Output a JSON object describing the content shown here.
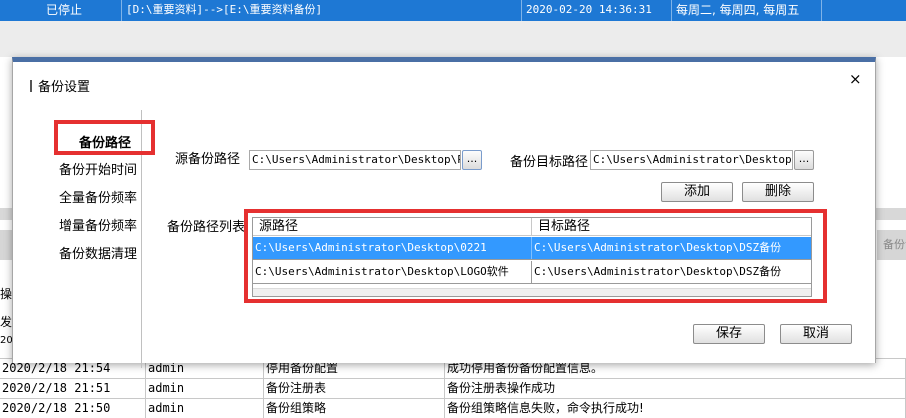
{
  "background": {
    "top_row": {
      "status": "已停止",
      "paths": "[D:\\重要资料]-->[E:\\重要资料备份]",
      "datetime": "2020-02-20 14:36:31",
      "schedule": "每周二, 每周四, 每周五"
    },
    "left_fragments": [
      "操",
      "发",
      "20"
    ],
    "right_fragment": "备份计",
    "log_rows": [
      {
        "time": "2020/2/18 21:54",
        "user": "admin",
        "action": "停用备份配置",
        "message": "成功停用备份备份配置信息。"
      },
      {
        "time": "2020/2/18 21:51",
        "user": "admin",
        "action": "备份注册表",
        "message": "备份注册表操作成功"
      },
      {
        "time": "2020/2/18 21:50",
        "user": "admin",
        "action": "备份组策略",
        "message": "备份组策略信息失败，命令执行成功!"
      }
    ]
  },
  "dialog": {
    "title": "备份设置",
    "close_glyph": "×",
    "sidebar": [
      {
        "label": "备份路径",
        "active": true
      },
      {
        "label": "备份开始时间",
        "active": false
      },
      {
        "label": "全量备份频率",
        "active": false
      },
      {
        "label": "增量备份频率",
        "active": false
      },
      {
        "label": "备份数据清理",
        "active": false
      }
    ],
    "source_label": "源备份路径",
    "source_value": "C:\\Users\\Administrator\\Desktop\\PDF转",
    "target_label": "备份目标路径",
    "target_value": "C:\\Users\\Administrator\\Desktop\\DS",
    "browse_glyph": "...",
    "add_label": "添加",
    "delete_label": "删除",
    "list_label": "备份路径列表",
    "table": {
      "headers": [
        "源路径",
        "目标路径"
      ],
      "rows": [
        {
          "source": "C:\\Users\\Administrator\\Desktop\\0221",
          "target": "C:\\Users\\Administrator\\Desktop\\DSZ备份",
          "selected": true
        },
        {
          "source": "C:\\Users\\Administrator\\Desktop\\LOGO软件",
          "target": "C:\\Users\\Administrator\\Desktop\\DSZ备份",
          "selected": false
        }
      ]
    },
    "save_label": "保存",
    "cancel_label": "取消"
  },
  "colors": {
    "highlight_red": "#e53030",
    "selection_blue": "#3399ff",
    "header_blue": "#1e78d4",
    "dialog_border": "#4a6fa5"
  }
}
